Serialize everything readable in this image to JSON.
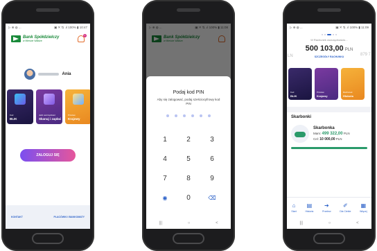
{
  "phone1": {
    "status_left": "▷ ⊕ ◍ ...",
    "status_right": "▣ ✕ ⇅ .ıl 100% ▮ 10:47",
    "bank_name": "Bank Spółdzielczy",
    "bank_sub": "w Mieście Wałdze",
    "bell_count": "1",
    "username": "Ania",
    "cards": [
      {
        "cap_small": "Kod",
        "cap_big": "BLIK"
      },
      {
        "cap_small": "Jeśli oszczędzasz",
        "cap_big": "Skanuj i zapłać"
      },
      {
        "cap_small": "Przelew",
        "cap_big": "Krajowy"
      }
    ],
    "login_label": "ZALOGUJ SIĘ",
    "link_left": "KONTAKT",
    "link_right": "PLACÓWKI I BANKOMATY"
  },
  "phone2": {
    "status_left": "▷ ⊕ ◍ ...",
    "status_right": "▣ ✕ ⇅ .ıl 100% ▮ 11:08",
    "title": "Podaj kod PIN",
    "desc": "Aby się zalogować, podaj sześciocyfrowy kod PIN",
    "keys": [
      "1",
      "2",
      "3",
      "4",
      "5",
      "6",
      "7",
      "8",
      "9",
      "◉",
      "0",
      "⌫"
    ],
    "nav": [
      "|||",
      "○",
      "<"
    ]
  },
  "phone3": {
    "status_left": "▷ ⊕ ◍ ...",
    "status_right": "▣ ✕ ⇅ .ıl 100% ▮ 11:09",
    "account_name": "Rachunek oszczędnościo...",
    "balance": "500 103,00",
    "currency": "PLN",
    "balance_right_peek": "879 7",
    "balance_left_peek": "LN",
    "details_label": "SZCZEGÓŁY RACHUNKU",
    "cards": [
      {
        "cap_small": "Kod",
        "cap_big": "BLIK"
      },
      {
        "cap_small": "Przelew",
        "cap_big": "Krajowy"
      },
      {
        "cap_small": "Rachunek",
        "cap_big": "Historia"
      }
    ],
    "savings_section": "Skarbonki",
    "savings_name": "Skarbonka",
    "have_label": "Mam:",
    "have_value": "499 322,00",
    "have_currency": "PLN",
    "goal_label": "Cel:",
    "goal_value": "10 000,00",
    "goal_currency": "PLN",
    "progress_pct": 100,
    "tabs": [
      {
        "glyph": "⌂",
        "label": "Start"
      },
      {
        "glyph": "▤",
        "label": "Historia"
      },
      {
        "glyph": "➔",
        "label": "Przelew"
      },
      {
        "glyph": "✐",
        "label": "Dla Ciebie"
      },
      {
        "glyph": "▦",
        "label": "Więcej"
      }
    ],
    "nav": [
      "|||",
      "○",
      "<"
    ]
  }
}
